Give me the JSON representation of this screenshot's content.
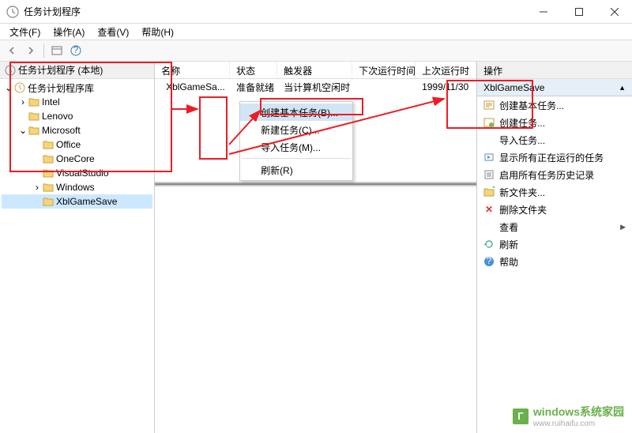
{
  "title": "任务计划程序",
  "menubar": [
    "文件(F)",
    "操作(A)",
    "查看(V)",
    "帮助(H)"
  ],
  "tree": {
    "root": "任务计划程序 (本地)",
    "lib": "任务计划程序库",
    "items": [
      "Intel",
      "Lenovo",
      "Microsoft",
      "Office",
      "OneCore",
      "VisualStudio",
      "Windows",
      "XblGameSave"
    ]
  },
  "columns": [
    "名称",
    "状态",
    "触发器",
    "下次运行时间",
    "上次运行时"
  ],
  "row": {
    "name": "XblGameSa...",
    "status": "准备就绪",
    "trigger": "当计算机空闲时",
    "next": "",
    "last": "1999/11/30"
  },
  "ctx": {
    "createBasic": "创建基本任务(B)...",
    "newTask": "新建任务(C)...",
    "importTask": "导入任务(M)...",
    "refresh": "刷新(R)"
  },
  "actions": {
    "title": "操作",
    "context": "XblGameSave",
    "createBasic": "创建基本任务...",
    "createTask": "创建任务...",
    "importTask": "导入任务...",
    "showRunning": "显示所有正在运行的任务",
    "enableHistory": "启用所有任务历史记录",
    "newFolder": "新文件夹...",
    "deleteFolder": "删除文件夹",
    "view": "查看",
    "refresh": "刷新",
    "help": "帮助"
  },
  "watermark": {
    "brand": "windows系统家园",
    "url": "www.ruihaifu.com"
  }
}
